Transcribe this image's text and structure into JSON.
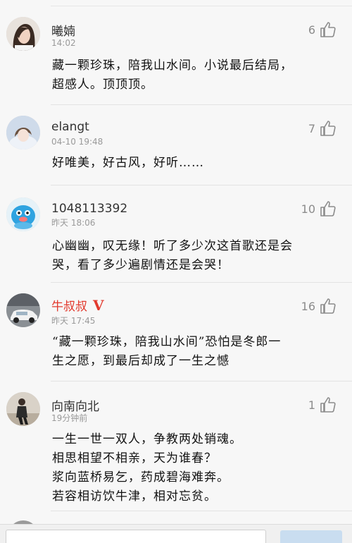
{
  "comments": [
    {
      "name": "曦婻",
      "time": "14:02",
      "likes": "6",
      "text": "藏一颗珍珠，陪我山水间。小说最后结局，\n超感人。顶顶顶。"
    },
    {
      "name": "elangt",
      "time": "04-10 19:48",
      "likes": "7",
      "text": "好唯美，好古风，好听……"
    },
    {
      "name": "1048113392",
      "time": "昨天 18:06",
      "likes": "10",
      "text": "心幽幽，叹无缘！听了多少次这首歌还是会\n哭，看了多少遍剧情还是会哭！"
    },
    {
      "name": "牛叔叔",
      "badge": "V",
      "time": "昨天 17:45",
      "likes": "16",
      "text": "“藏一颗珍珠，陪我山水间”恐怕是冬郎一\n生之愿，到最后却成了一生之憾"
    },
    {
      "name": "向南向北",
      "time": "19分钟前",
      "likes": "1",
      "text": "一生一世一双人，争教两处销魂。\n相思相望不相亲，天为谁春？\n浆向蓝桥易乞，药成碧海难奔。\n若容相访饮牛津，相对忘贫。"
    }
  ],
  "colors": {
    "vip_name": "#e23a2e",
    "like_icon": "#8c8c8c",
    "send_button": "#c9ddf0"
  },
  "icons": {
    "like": "thumbs-up-icon"
  }
}
